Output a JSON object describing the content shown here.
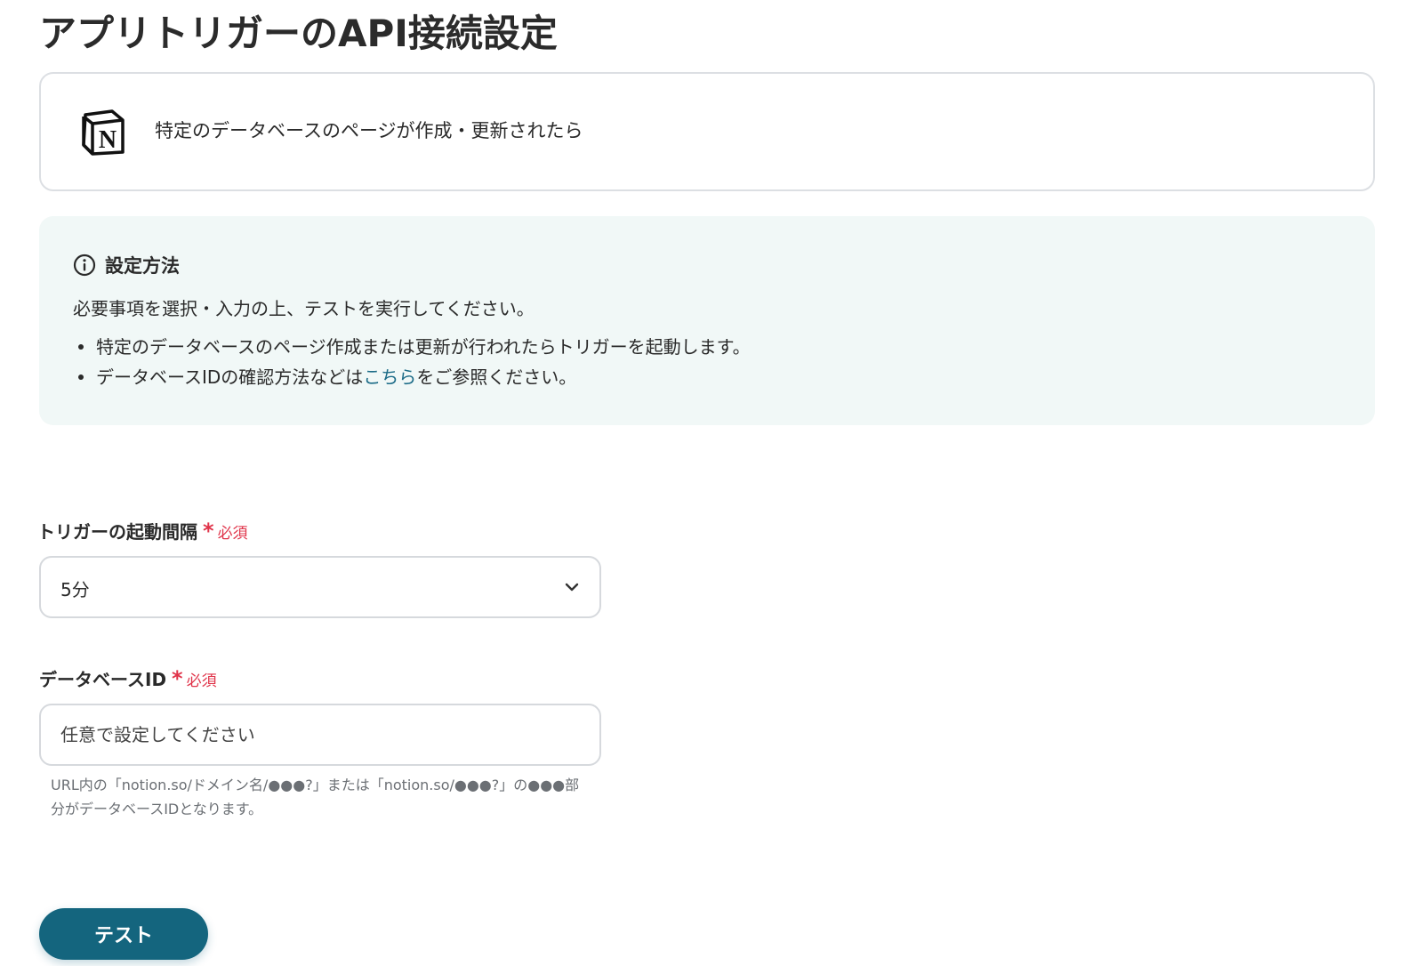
{
  "page": {
    "title": "アプリトリガーのAPI接続設定"
  },
  "trigger": {
    "app_icon": "notion-logo",
    "label": "特定のデータベースのページが作成・更新されたら"
  },
  "info": {
    "icon": "info-circle-icon",
    "title": "設定方法",
    "description": "必要事項を選択・入力の上、テストを実行してください。",
    "bullets": {
      "first": "特定のデータベースのページ作成または更新が行われたらトリガーを起動します。",
      "second_prefix": "データベースIDの確認方法などは",
      "second_link": "こちら",
      "second_suffix": "をご参照ください。"
    }
  },
  "interval_field": {
    "label": "トリガーの起動間隔",
    "required_mark": "*",
    "required_text": "必須",
    "selected_value": "5分"
  },
  "database_field": {
    "label": "データベースID",
    "required_mark": "*",
    "required_text": "必須",
    "placeholder": "任意で設定してください",
    "hint": "URL内の「notion.so/ドメイン名/●●●?」または「notion.so/●●●?」の●●●部分がデータベースIDとなります。"
  },
  "actions": {
    "test_label": "テスト"
  },
  "colors": {
    "primary": "#14657e",
    "link": "#1b6b87",
    "required": "#e0344a",
    "info_background": "#f1f8f7"
  }
}
